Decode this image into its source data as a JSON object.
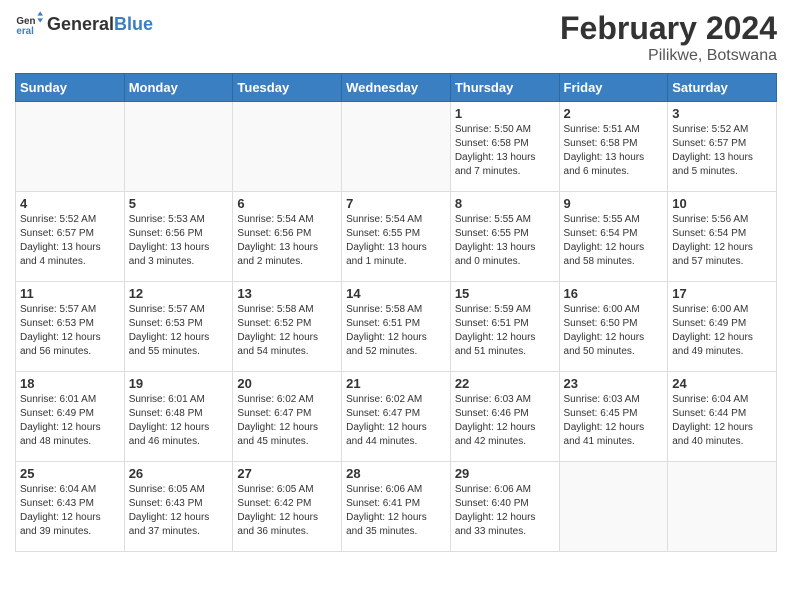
{
  "header": {
    "logo_general": "General",
    "logo_blue": "Blue",
    "main_title": "February 2024",
    "subtitle": "Pilikwe, Botswana"
  },
  "days_of_week": [
    "Sunday",
    "Monday",
    "Tuesday",
    "Wednesday",
    "Thursday",
    "Friday",
    "Saturday"
  ],
  "weeks": [
    [
      {
        "day": "",
        "info": ""
      },
      {
        "day": "",
        "info": ""
      },
      {
        "day": "",
        "info": ""
      },
      {
        "day": "",
        "info": ""
      },
      {
        "day": "1",
        "info": "Sunrise: 5:50 AM\nSunset: 6:58 PM\nDaylight: 13 hours\nand 7 minutes."
      },
      {
        "day": "2",
        "info": "Sunrise: 5:51 AM\nSunset: 6:58 PM\nDaylight: 13 hours\nand 6 minutes."
      },
      {
        "day": "3",
        "info": "Sunrise: 5:52 AM\nSunset: 6:57 PM\nDaylight: 13 hours\nand 5 minutes."
      }
    ],
    [
      {
        "day": "4",
        "info": "Sunrise: 5:52 AM\nSunset: 6:57 PM\nDaylight: 13 hours\nand 4 minutes."
      },
      {
        "day": "5",
        "info": "Sunrise: 5:53 AM\nSunset: 6:56 PM\nDaylight: 13 hours\nand 3 minutes."
      },
      {
        "day": "6",
        "info": "Sunrise: 5:54 AM\nSunset: 6:56 PM\nDaylight: 13 hours\nand 2 minutes."
      },
      {
        "day": "7",
        "info": "Sunrise: 5:54 AM\nSunset: 6:55 PM\nDaylight: 13 hours\nand 1 minute."
      },
      {
        "day": "8",
        "info": "Sunrise: 5:55 AM\nSunset: 6:55 PM\nDaylight: 13 hours\nand 0 minutes."
      },
      {
        "day": "9",
        "info": "Sunrise: 5:55 AM\nSunset: 6:54 PM\nDaylight: 12 hours\nand 58 minutes."
      },
      {
        "day": "10",
        "info": "Sunrise: 5:56 AM\nSunset: 6:54 PM\nDaylight: 12 hours\nand 57 minutes."
      }
    ],
    [
      {
        "day": "11",
        "info": "Sunrise: 5:57 AM\nSunset: 6:53 PM\nDaylight: 12 hours\nand 56 minutes."
      },
      {
        "day": "12",
        "info": "Sunrise: 5:57 AM\nSunset: 6:53 PM\nDaylight: 12 hours\nand 55 minutes."
      },
      {
        "day": "13",
        "info": "Sunrise: 5:58 AM\nSunset: 6:52 PM\nDaylight: 12 hours\nand 54 minutes."
      },
      {
        "day": "14",
        "info": "Sunrise: 5:58 AM\nSunset: 6:51 PM\nDaylight: 12 hours\nand 52 minutes."
      },
      {
        "day": "15",
        "info": "Sunrise: 5:59 AM\nSunset: 6:51 PM\nDaylight: 12 hours\nand 51 minutes."
      },
      {
        "day": "16",
        "info": "Sunrise: 6:00 AM\nSunset: 6:50 PM\nDaylight: 12 hours\nand 50 minutes."
      },
      {
        "day": "17",
        "info": "Sunrise: 6:00 AM\nSunset: 6:49 PM\nDaylight: 12 hours\nand 49 minutes."
      }
    ],
    [
      {
        "day": "18",
        "info": "Sunrise: 6:01 AM\nSunset: 6:49 PM\nDaylight: 12 hours\nand 48 minutes."
      },
      {
        "day": "19",
        "info": "Sunrise: 6:01 AM\nSunset: 6:48 PM\nDaylight: 12 hours\nand 46 minutes."
      },
      {
        "day": "20",
        "info": "Sunrise: 6:02 AM\nSunset: 6:47 PM\nDaylight: 12 hours\nand 45 minutes."
      },
      {
        "day": "21",
        "info": "Sunrise: 6:02 AM\nSunset: 6:47 PM\nDaylight: 12 hours\nand 44 minutes."
      },
      {
        "day": "22",
        "info": "Sunrise: 6:03 AM\nSunset: 6:46 PM\nDaylight: 12 hours\nand 42 minutes."
      },
      {
        "day": "23",
        "info": "Sunrise: 6:03 AM\nSunset: 6:45 PM\nDaylight: 12 hours\nand 41 minutes."
      },
      {
        "day": "24",
        "info": "Sunrise: 6:04 AM\nSunset: 6:44 PM\nDaylight: 12 hours\nand 40 minutes."
      }
    ],
    [
      {
        "day": "25",
        "info": "Sunrise: 6:04 AM\nSunset: 6:43 PM\nDaylight: 12 hours\nand 39 minutes."
      },
      {
        "day": "26",
        "info": "Sunrise: 6:05 AM\nSunset: 6:43 PM\nDaylight: 12 hours\nand 37 minutes."
      },
      {
        "day": "27",
        "info": "Sunrise: 6:05 AM\nSunset: 6:42 PM\nDaylight: 12 hours\nand 36 minutes."
      },
      {
        "day": "28",
        "info": "Sunrise: 6:06 AM\nSunset: 6:41 PM\nDaylight: 12 hours\nand 35 minutes."
      },
      {
        "day": "29",
        "info": "Sunrise: 6:06 AM\nSunset: 6:40 PM\nDaylight: 12 hours\nand 33 minutes."
      },
      {
        "day": "",
        "info": ""
      },
      {
        "day": "",
        "info": ""
      }
    ]
  ]
}
